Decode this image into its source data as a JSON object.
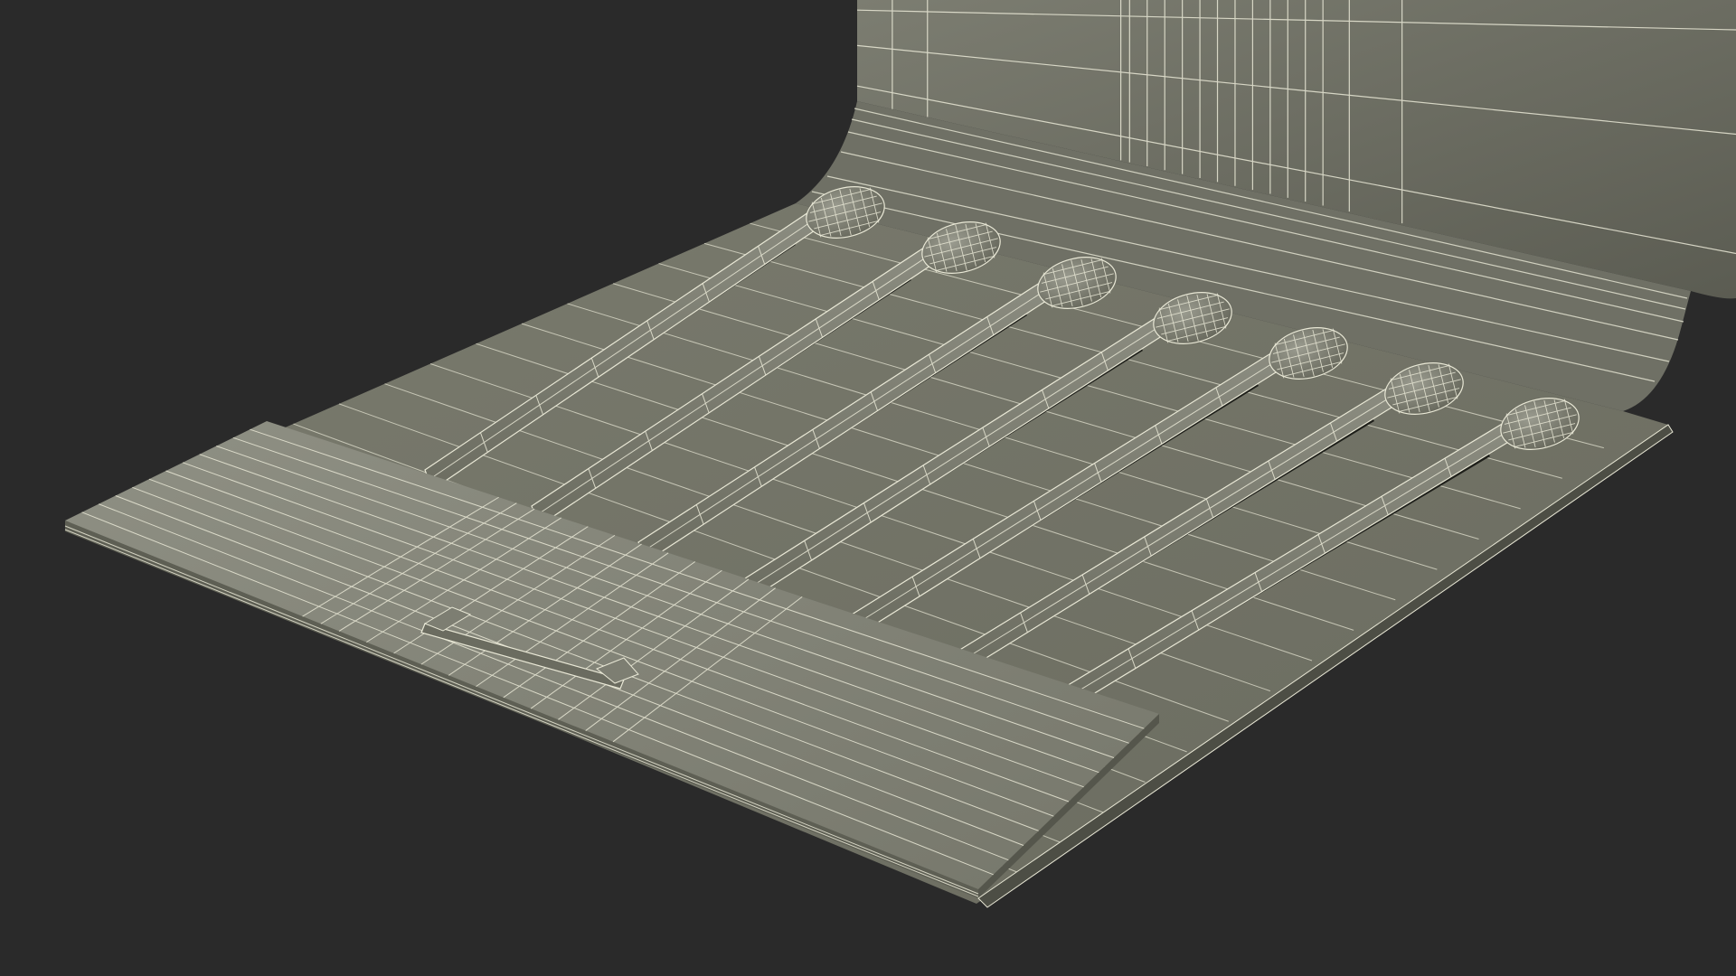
{
  "scene": {
    "subject": "wireframe-matchbook-render",
    "colors": {
      "background": "#2a2a2a",
      "surface_light": "#8d8e82",
      "surface_mid": "#767769",
      "surface_dark": "#5f6055",
      "wire": "#e9e8d6",
      "shadow": "#1e1f1a"
    },
    "match_count": 7
  }
}
